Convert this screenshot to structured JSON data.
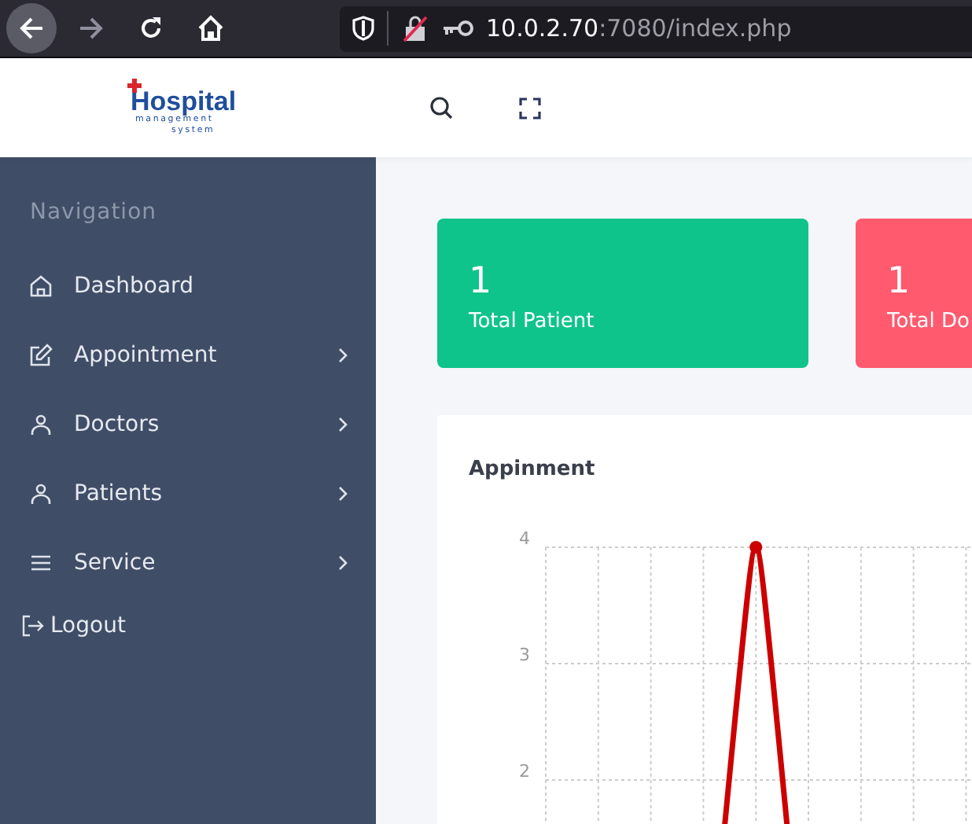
{
  "browser": {
    "url_host": "10.0.2.70",
    "url_rest": ":7080/index.php",
    "back_enabled": true,
    "forward_enabled": false
  },
  "header": {
    "logo": {
      "name": "Hospital",
      "tagline_1": "management",
      "tagline_2": "system"
    }
  },
  "sidebar": {
    "heading": "Navigation",
    "items": [
      {
        "label": "Dashboard",
        "has_submenu": false
      },
      {
        "label": "Appointment",
        "has_submenu": true
      },
      {
        "label": "Doctors",
        "has_submenu": true
      },
      {
        "label": "Patients",
        "has_submenu": true
      },
      {
        "label": "Service",
        "has_submenu": true
      }
    ],
    "logout": "Logout"
  },
  "stats": [
    {
      "value": "1",
      "label": "Total Patient",
      "color": "#0fc48a"
    },
    {
      "value": "1",
      "label": "Total Do",
      "color": "#ff5a6e"
    }
  ],
  "chart": {
    "title": "Appinment",
    "y_tick_labels": [
      "4",
      "3",
      "2"
    ]
  }
}
